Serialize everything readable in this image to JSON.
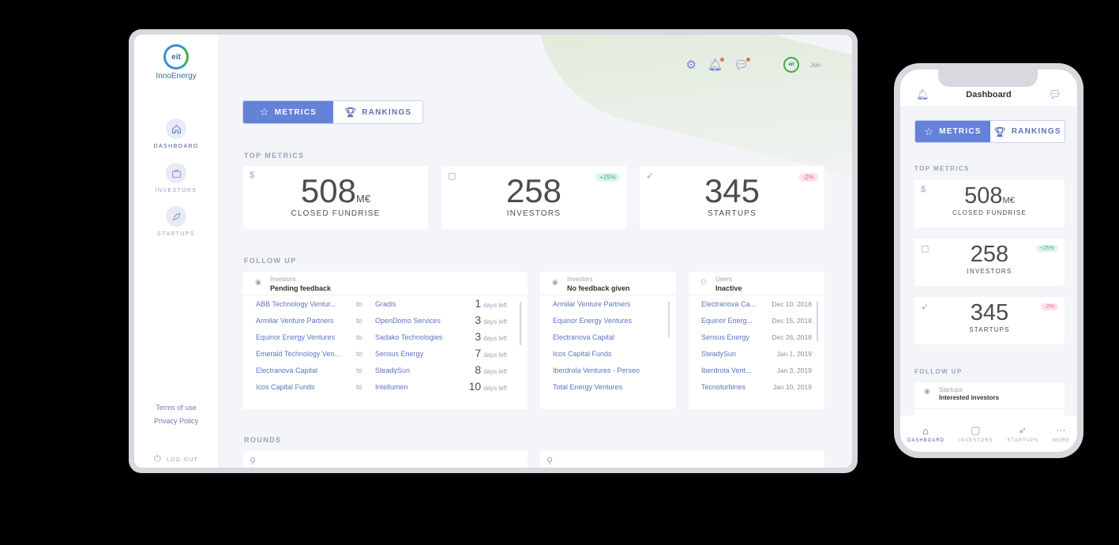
{
  "brand": {
    "logo_mark": "eit",
    "name": "InnoEnergy"
  },
  "sidebar": {
    "items": [
      {
        "label": "DASHBOARD",
        "icon": "home-icon"
      },
      {
        "label": "INVESTORS",
        "icon": "briefcase-icon"
      },
      {
        "label": "STARTUPS",
        "icon": "rocket-icon"
      }
    ],
    "terms": "Terms of use",
    "privacy": "Privacy Policy",
    "logout": "LOG OUT"
  },
  "header": {
    "user_name": "Jon",
    "avatar_text": "eit"
  },
  "tabs": {
    "metrics": "METRICS",
    "rankings": "RANKINGS"
  },
  "sections": {
    "top_metrics": "TOP METRICS",
    "follow_up": "FOLLOW UP",
    "rounds": "ROUNDS"
  },
  "metrics": [
    {
      "icon": "$",
      "value": "508",
      "unit": "M€",
      "caption": "CLOSED FUNDRISE",
      "badge": ""
    },
    {
      "icon": "briefcase-icon",
      "value": "258",
      "unit": "",
      "caption": "INVESTORS",
      "badge": "+25%"
    },
    {
      "icon": "rocket-icon",
      "value": "345",
      "unit": "",
      "caption": "STARTUPS",
      "badge": "-2%"
    }
  ],
  "followup": {
    "pending": {
      "subtitle": "Investors",
      "title": "Pending feedback",
      "to_label": "to",
      "days_label": "days left",
      "rows": [
        {
          "from": "ABB Technology Ventur...",
          "to": "Gradis",
          "days": "1"
        },
        {
          "from": "Armilar Venture Partners",
          "to": "OpenDomo Services",
          "days": "3"
        },
        {
          "from": "Equinor Energy Ventures",
          "to": "Sadako Technologies",
          "days": "3"
        },
        {
          "from": "Emerald Technology Ven...",
          "to": "Sensus Energy",
          "days": "7"
        },
        {
          "from": "Electranova Capital",
          "to": "SteadySun",
          "days": "8"
        },
        {
          "from": "Icos Capital Funds",
          "to": "Intellumen",
          "days": "10"
        }
      ]
    },
    "nofeedback": {
      "subtitle": "Investors",
      "title": "No feedback given",
      "rows": [
        "Armilar Venture Partners",
        "Equinor Energy Ventures",
        "Electranova Capital",
        "Icos Capital Funds",
        "Iberdrola Ventures - Perseo",
        "Total Energy Ventures"
      ]
    },
    "inactive": {
      "subtitle": "Users",
      "title": "Inactive",
      "rows": [
        {
          "name": "Electranova Ca...",
          "date": "Dec 10, 2018"
        },
        {
          "name": "Equinor Energ...",
          "date": "Dec 15, 2018"
        },
        {
          "name": "Sensus Energy",
          "date": "Dec 26, 2018"
        },
        {
          "name": "SteadySun",
          "date": "Jan 1, 2019"
        },
        {
          "name": "Iberdrola Vent...",
          "date": "Jan 3, 2019"
        },
        {
          "name": "Tecnoturbines",
          "date": "Jan 10, 2019"
        }
      ]
    }
  },
  "phone": {
    "title": "Dashboard",
    "followup_card": {
      "subtitle": "Startups",
      "title": "Interested investors"
    },
    "nav": [
      "DASHBOARD",
      "INVESTORS",
      "STARTUPS",
      "MORE"
    ]
  }
}
